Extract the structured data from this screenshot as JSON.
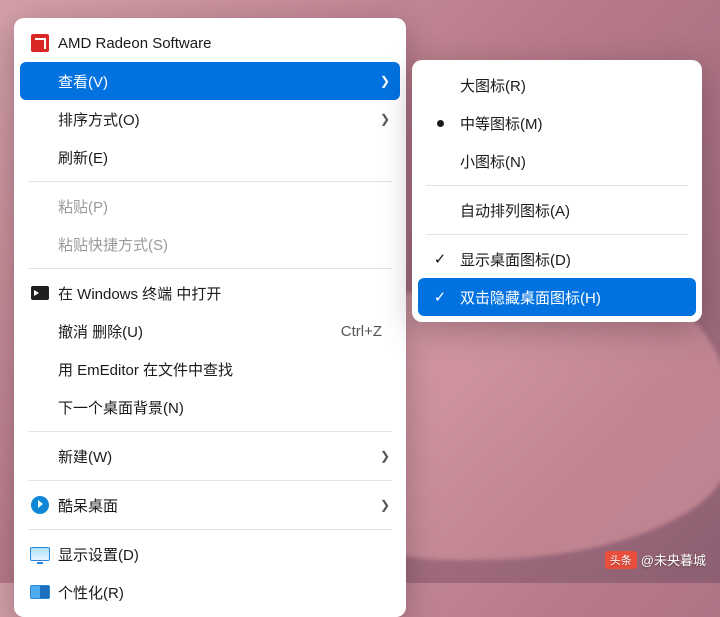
{
  "mainMenu": {
    "items": [
      {
        "label": "AMD Radeon Software",
        "icon": "amd-icon"
      },
      {
        "label": "查看(V)",
        "hasSubmenu": true,
        "highlighted": true
      },
      {
        "label": "排序方式(O)",
        "hasSubmenu": true
      },
      {
        "label": "刷新(E)"
      },
      {
        "separator": true
      },
      {
        "label": "粘贴(P)",
        "disabled": true
      },
      {
        "label": "粘贴快捷方式(S)",
        "disabled": true
      },
      {
        "separator": true
      },
      {
        "label": "在 Windows 终端 中打开",
        "icon": "terminal-icon"
      },
      {
        "label": "撤消 删除(U)",
        "shortcut": "Ctrl+Z"
      },
      {
        "label": "用 EmEditor 在文件中查找"
      },
      {
        "label": "下一个桌面背景(N)"
      },
      {
        "separator": true
      },
      {
        "label": "新建(W)",
        "hasSubmenu": true
      },
      {
        "separator": true
      },
      {
        "label": "酷呆桌面",
        "icon": "coodesker-icon",
        "hasSubmenu": true
      },
      {
        "separator": true
      },
      {
        "label": "显示设置(D)",
        "icon": "display-settings-icon"
      },
      {
        "label": "个性化(R)",
        "icon": "personalize-icon"
      }
    ]
  },
  "subMenu": {
    "items": [
      {
        "label": "大图标(R)"
      },
      {
        "label": "中等图标(M)",
        "marker": "bullet"
      },
      {
        "label": "小图标(N)"
      },
      {
        "separator": true
      },
      {
        "label": "自动排列图标(A)"
      },
      {
        "separator": true
      },
      {
        "label": "显示桌面图标(D)",
        "marker": "check"
      },
      {
        "label": "双击隐藏桌面图标(H)",
        "marker": "check",
        "highlighted": true
      }
    ]
  },
  "watermark": {
    "badge": "头条",
    "author": "@未央暮城"
  },
  "icons": {
    "submenuArrow": "❯"
  }
}
